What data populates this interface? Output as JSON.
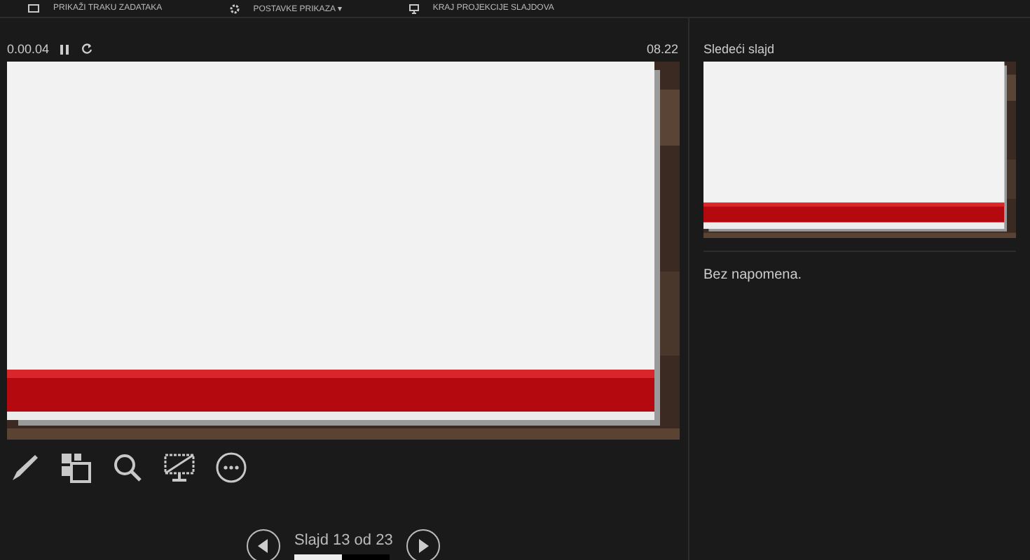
{
  "toolbar": [
    {
      "label": "PRIKAŽI TRAKU ZADATAKA",
      "kind": "taskbar"
    },
    {
      "label": "POSTAVKE PRIKAZA ▾",
      "kind": "gear"
    },
    {
      "label": "KRAJ PROJEKCIJE SLAJDOVA",
      "kind": "monitor"
    }
  ],
  "timer": {
    "elapsed": "0.00.04",
    "clock": "08.22"
  },
  "tools": [
    {
      "kind": "pen"
    },
    {
      "kind": "slides"
    },
    {
      "kind": "zoom"
    },
    {
      "kind": "black"
    },
    {
      "kind": "more"
    }
  ],
  "navigation": {
    "label": "Slajd 13 od 23",
    "level": 0.5
  },
  "next_slide": {
    "title": "Sledeći slajd"
  },
  "notes": {
    "text": "Bez napomena."
  }
}
